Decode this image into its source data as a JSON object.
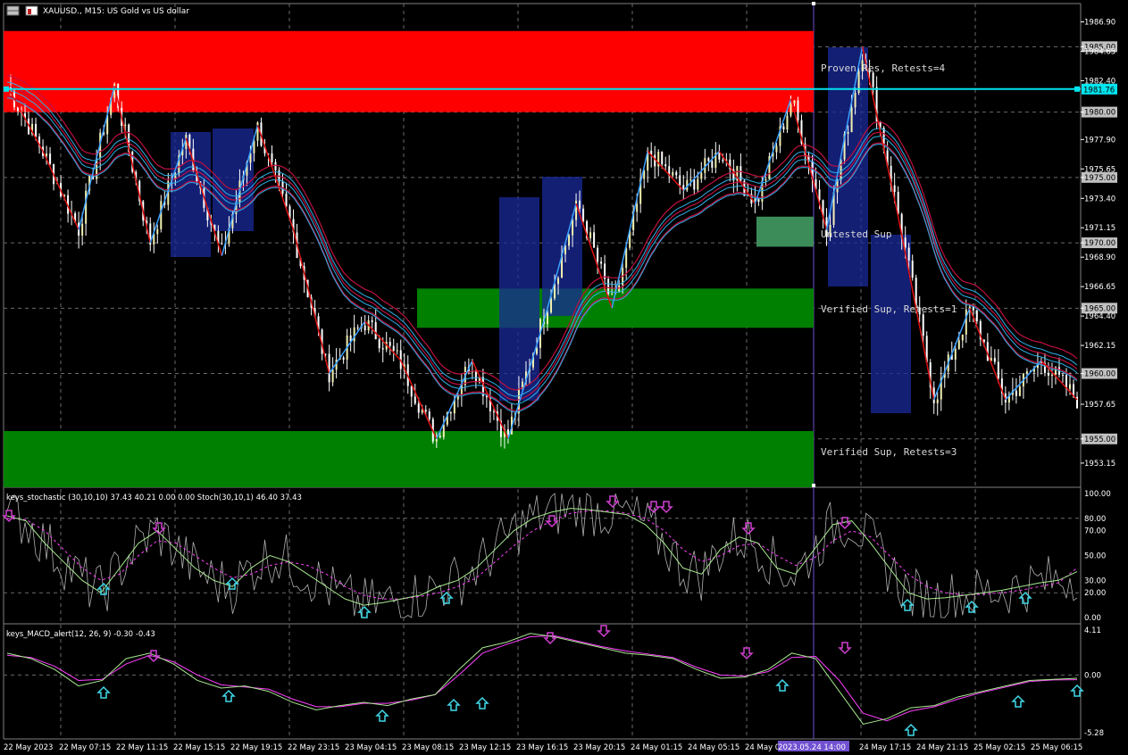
{
  "header": {
    "symbol_text": "XAUUSD., M15:  US Gold vs US dollar",
    "stoch_title": "keys_stochastic (30,10,10) 37.43 40.21 0.00 0.00 Stoch(30,10,1) 46.40 37.43",
    "macd_title": "keys_MACD_alert(12, 26, 9) -0.30 -0.43"
  },
  "colors": {
    "background": "#000000",
    "resistance_zone": "#ff0000",
    "support_zone": "#008000",
    "untested_zone": "#3c8c5a",
    "zigzag_up": "#3aa0ff",
    "zigzag_down": "#e01010",
    "ma_red": "#c01040",
    "ma_blue": "#30b0e8",
    "hline": "#00e5ee",
    "candle": "#ffffff",
    "candle_yellow": "#f0f0b0",
    "stoch_main": "#a8e890",
    "stoch_signal": "#ff40ff",
    "stoch_raw": "#b0b0b0",
    "macd_main": "#a8e890",
    "macd_signal": "#ff40ff",
    "arrow_up": "#40d8e8",
    "arrow_down": "#d040d0"
  },
  "chart_data": [
    {
      "type": "candlestick",
      "title": "XAUUSD., M15:  US Gold vs US dollar",
      "ylim": [
        1951.3,
        1988.3
      ],
      "y_ticks": [
        "1986.90",
        "1985.00",
        "1984.65",
        "1982.40",
        "1981.76",
        "1980.00",
        "1977.90",
        "1975.65",
        "1975.00",
        "1973.40",
        "1971.15",
        "1970.00",
        "1968.90",
        "1966.65",
        "1965.00",
        "1964.40",
        "1962.15",
        "1960.00",
        "1957.65",
        "1955.00",
        "1953.15"
      ],
      "x_ticks": [
        "22 May 2023",
        "22 May 07:15",
        "22 May 11:15",
        "22 May 15:15",
        "22 May 19:15",
        "22 May 23:15",
        "23 May 04:15",
        "23 May 08:15",
        "23 May 12:15",
        "23 May 16:15",
        "23 May 20:15",
        "24 May 01:15",
        "24 May 05:15",
        "24 May 09:15",
        "2023.05.24 14:00",
        "24 May 17:15",
        "24 May 21:15",
        "25 May 02:15",
        "25 May 06:15"
      ],
      "current_price": "1981.76",
      "price_marks": [
        "1985.00",
        "1980.00",
        "1975.00",
        "1970.00",
        "1965.00",
        "1960.00",
        "1955.00"
      ],
      "zones": [
        {
          "kind": "resistance",
          "low": 1980.0,
          "high": 1986.2,
          "label": "Proven Res, Retests=4"
        },
        {
          "kind": "untested",
          "low": 1969.7,
          "high": 1972.0,
          "label": "Untested Sup"
        },
        {
          "kind": "support",
          "low": 1963.5,
          "high": 1966.5,
          "label": "Verified Sup, Retests=1"
        },
        {
          "kind": "support",
          "low": 1951.3,
          "high": 1955.6,
          "label": "Verified Sup, Retests=3"
        }
      ],
      "zigzag": [
        1982,
        1977,
        1971,
        1982,
        1970,
        1978,
        1969,
        1979,
        1971,
        1960,
        1964,
        1961,
        1955,
        1961,
        1955,
        1964,
        1973,
        1965,
        1977,
        1974,
        1977,
        1973,
        1981,
        1971,
        1985,
        1972,
        1958,
        1965,
        1958,
        1961,
        1958
      ]
    },
    {
      "type": "line",
      "title": "keys_stochastic (30,10,10) 37.43 40.21 0.00 0.00 Stoch(30,10,1) 46.40 37.43",
      "ylim": [
        0,
        100
      ],
      "y_ticks": [
        "100.00",
        "80.00",
        "70.00",
        "50.00",
        "30.00",
        "20.00",
        "0.00"
      ],
      "series": [
        {
          "values": [
            82,
            78,
            60,
            45,
            30,
            20,
            40,
            60,
            70,
            55,
            40,
            30,
            25,
            40,
            50,
            45,
            35,
            25,
            15,
            10,
            12,
            15,
            18,
            25,
            30,
            40,
            55,
            70,
            80,
            85,
            88,
            87,
            85,
            83,
            75,
            60,
            40,
            35,
            55,
            65,
            60,
            40,
            35,
            55,
            75,
            78,
            60,
            40,
            20,
            15,
            16,
            18,
            20,
            22,
            25,
            28,
            30,
            37
          ]
        },
        {
          "values": [
            80,
            79,
            70,
            55,
            40,
            30,
            35,
            50,
            62,
            60,
            50,
            40,
            32,
            35,
            42,
            45,
            42,
            35,
            25,
            18,
            15,
            15,
            17,
            20,
            25,
            32,
            45,
            58,
            70,
            78,
            84,
            86,
            86,
            84,
            80,
            70,
            55,
            45,
            50,
            58,
            60,
            50,
            42,
            48,
            62,
            70,
            65,
            50,
            35,
            25,
            20,
            18,
            19,
            20,
            22,
            25,
            28,
            40
          ]
        }
      ]
    },
    {
      "type": "line",
      "title": "keys_MACD_alert(12, 26, 9) -0.30 -0.43",
      "ylim": [
        -5.28,
        4.11
      ],
      "y_ticks": [
        "4.11",
        "0.00",
        "-5.28"
      ],
      "series": [
        {
          "values": [
            2.0,
            1.5,
            0.5,
            -1.0,
            -0.5,
            1.5,
            2.0,
            1.0,
            -0.5,
            -1.2,
            -1.0,
            -1.5,
            -2.5,
            -3.2,
            -2.8,
            -2.5,
            -2.8,
            -2.2,
            -1.8,
            0.5,
            2.5,
            3.0,
            3.8,
            3.5,
            3.0,
            2.5,
            2.0,
            1.8,
            1.5,
            0.5,
            -0.3,
            -0.2,
            0.5,
            2.0,
            1.5,
            -1.5,
            -4.5,
            -4.0,
            -3.0,
            -2.8,
            -2.0,
            -1.5,
            -1.0,
            -0.5,
            -0.4,
            -0.3
          ]
        },
        {
          "values": [
            1.8,
            1.6,
            0.8,
            -0.5,
            -0.4,
            1.0,
            1.8,
            1.2,
            0.0,
            -0.9,
            -1.1,
            -1.3,
            -2.2,
            -2.9,
            -2.9,
            -2.6,
            -2.6,
            -2.3,
            -1.8,
            0.0,
            2.0,
            2.8,
            3.5,
            3.6,
            3.1,
            2.6,
            2.2,
            1.9,
            1.6,
            0.7,
            0.0,
            -0.1,
            0.3,
            1.6,
            1.7,
            -0.5,
            -3.5,
            -4.2,
            -3.3,
            -2.9,
            -2.2,
            -1.6,
            -1.1,
            -0.6,
            -0.45,
            -0.43
          ]
        }
      ]
    }
  ]
}
